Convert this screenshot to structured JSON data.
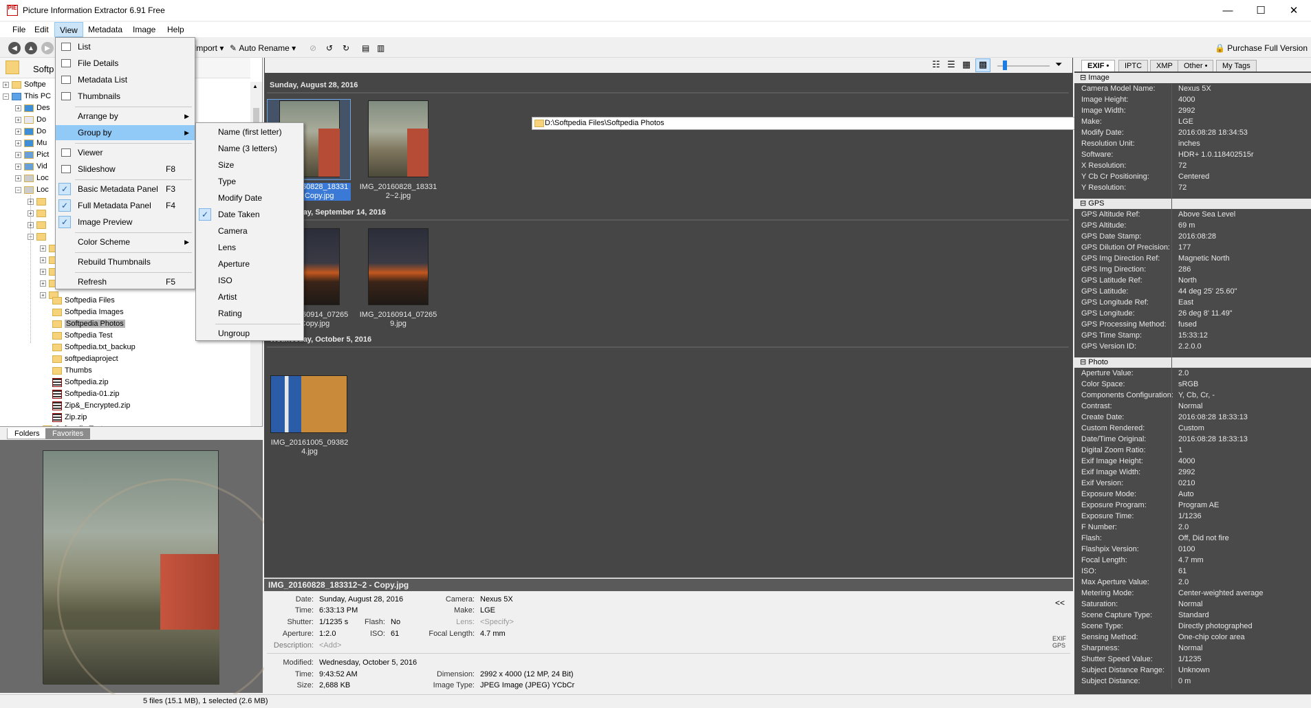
{
  "window": {
    "title": "Picture Information Extractor 6.91 Free",
    "app_icon": "PIE",
    "min": "—",
    "max": "☐",
    "close": "✕"
  },
  "menubar": [
    "File",
    "Edit",
    "View",
    "Metadata",
    "Image",
    "Help"
  ],
  "toolbar": {
    "import": "Import",
    "auto_rename": "Auto Rename",
    "purchase": "Purchase Full Version"
  },
  "tree": {
    "top": [
      {
        "label": "Softp"
      },
      {
        "label": "Softpe"
      },
      {
        "label": "This PC"
      },
      {
        "label": "Des"
      },
      {
        "label": "Do"
      },
      {
        "label": "Do"
      },
      {
        "label": "Mu"
      },
      {
        "label": "Pict"
      },
      {
        "label": "Vid"
      },
      {
        "label": "Loc"
      },
      {
        "label": "Loc"
      }
    ],
    "items": [
      {
        "label": "Softpedia Files",
        "type": "folder"
      },
      {
        "label": "Softpedia Images",
        "type": "folder"
      },
      {
        "label": "Softpedia Photos",
        "type": "folder"
      },
      {
        "label": "Softpedia Test",
        "type": "folder"
      },
      {
        "label": "Softpedia.txt_backup",
        "type": "folder"
      },
      {
        "label": "softpediaproject",
        "type": "folder"
      },
      {
        "label": "Thumbs",
        "type": "folder"
      },
      {
        "label": "Softpedia.zip",
        "type": "zip"
      },
      {
        "label": "Softpedia-01.zip",
        "type": "zip"
      },
      {
        "label": "Zip&_Encrypted.zip",
        "type": "zip"
      },
      {
        "label": "Zip.zip",
        "type": "zip"
      },
      {
        "label": "Softpedia Test",
        "type": "folder"
      }
    ]
  },
  "left_tabs": [
    "Folders",
    "Favorites"
  ],
  "path": "D:\\Softpedia Files\\Softpedia Photos",
  "groups": [
    {
      "label": "Sunday, August 28, 2016",
      "thumbs": [
        {
          "caption": "IMG_20160828_18331\n2~2 - Copy.jpg"
        },
        {
          "caption": "IMG_20160828_18331\n2~2.jpg"
        }
      ]
    },
    {
      "label": "Wednesday, September 14, 2016",
      "thumbs": [
        {
          "caption": "IMG_20160914_07265\n9 - Copy.jpg"
        },
        {
          "caption": "IMG_20160914_07265\n9.jpg"
        }
      ]
    },
    {
      "label": "Wednesday, October 5, 2016",
      "thumbs": [
        {
          "caption": "IMG_20161005_09382\n4.jpg"
        }
      ]
    }
  ],
  "info": {
    "title": "IMG_20160828_183312~2 - Copy.jpg",
    "date_l": "Date:",
    "date": "Sunday, August 28, 2016",
    "time_l": "Time:",
    "time": "6:33:13 PM",
    "shutter_l": "Shutter:",
    "shutter": "1/1235 s",
    "flash_l": "Flash:",
    "flash": "No",
    "aperture_l": "Aperture:",
    "aperture": "1:2.0",
    "iso_l": "ISO:",
    "iso": "61",
    "desc_l": "Description:",
    "desc": "<Add>",
    "camera_l": "Camera:",
    "camera": "Nexus 5X",
    "make_l": "Make:",
    "make": "LGE",
    "lens_l": "Lens:",
    "lens": "<Specify>",
    "focal_l": "Focal Length:",
    "focal": "4.7 mm",
    "collapse": "<<",
    "exif": "EXIF",
    "gps": "GPS",
    "modified_l": "Modified:",
    "modified": "Wednesday, October 5, 2016",
    "mtime_l": "Time:",
    "mtime": "9:43:52 AM",
    "size_l": "Size:",
    "size": "2,688 KB",
    "dim_l": "Dimension:",
    "dim": "2992 x 4000 (12 MP, 24 Bit)",
    "type_l": "Image Type:",
    "type": "JPEG Image (JPEG) YCbCr"
  },
  "right_tabs": [
    "EXIF •",
    "IPTC",
    "XMP",
    "Other •",
    "My Tags"
  ],
  "metadata": [
    {
      "section": "Image",
      "rows": [
        [
          "Camera Model Name:",
          "Nexus 5X"
        ],
        [
          "Image Height:",
          "4000"
        ],
        [
          "Image Width:",
          "2992"
        ],
        [
          "Make:",
          "LGE"
        ],
        [
          "Modify Date:",
          "2016:08:28 18:34:53"
        ],
        [
          "Resolution Unit:",
          "inches"
        ],
        [
          "Software:",
          "HDR+ 1.0.118402515r"
        ],
        [
          "X Resolution:",
          "72"
        ],
        [
          "Y Cb Cr Positioning:",
          "Centered"
        ],
        [
          "Y Resolution:",
          "72"
        ]
      ]
    },
    {
      "section": "GPS",
      "rows": [
        [
          "GPS Altitude Ref:",
          "Above Sea Level"
        ],
        [
          "GPS Altitude:",
          "69 m"
        ],
        [
          "GPS Date Stamp:",
          "2016:08:28"
        ],
        [
          "GPS Dilution Of Precision:",
          "177"
        ],
        [
          "GPS Img Direction Ref:",
          "Magnetic North"
        ],
        [
          "GPS Img Direction:",
          "286"
        ],
        [
          "GPS Latitude Ref:",
          "North"
        ],
        [
          "GPS Latitude:",
          "44 deg 25' 25.60\""
        ],
        [
          "GPS Longitude Ref:",
          "East"
        ],
        [
          "GPS Longitude:",
          "26 deg 8' 11.49\""
        ],
        [
          "GPS Processing Method:",
          "fused"
        ],
        [
          "GPS Time Stamp:",
          "15:33:12"
        ],
        [
          "GPS Version ID:",
          "2.2.0.0"
        ]
      ]
    },
    {
      "section": "Photo",
      "rows": [
        [
          "Aperture Value:",
          "2.0"
        ],
        [
          "Color Space:",
          "sRGB"
        ],
        [
          "Components Configuration:",
          "Y, Cb, Cr, -"
        ],
        [
          "Contrast:",
          "Normal"
        ],
        [
          "Create Date:",
          "2016:08:28 18:33:13"
        ],
        [
          "Custom Rendered:",
          "Custom"
        ],
        [
          "Date/Time Original:",
          "2016:08:28 18:33:13"
        ],
        [
          "Digital Zoom Ratio:",
          "1"
        ],
        [
          "Exif Image Height:",
          "4000"
        ],
        [
          "Exif Image Width:",
          "2992"
        ],
        [
          "Exif Version:",
          "0210"
        ],
        [
          "Exposure Mode:",
          "Auto"
        ],
        [
          "Exposure Program:",
          "Program AE"
        ],
        [
          "Exposure Time:",
          "1/1236"
        ],
        [
          "F Number:",
          "2.0"
        ],
        [
          "Flash:",
          "Off, Did not fire"
        ],
        [
          "Flashpix Version:",
          "0100"
        ],
        [
          "Focal Length:",
          "4.7 mm"
        ],
        [
          "ISO:",
          "61"
        ],
        [
          "Max Aperture Value:",
          "2.0"
        ],
        [
          "Metering Mode:",
          "Center-weighted average"
        ],
        [
          "Saturation:",
          "Normal"
        ],
        [
          "Scene Capture Type:",
          "Standard"
        ],
        [
          "Scene Type:",
          "Directly photographed"
        ],
        [
          "Sensing Method:",
          "One-chip color area"
        ],
        [
          "Sharpness:",
          "Normal"
        ],
        [
          "Shutter Speed Value:",
          "1/1235"
        ],
        [
          "Subject Distance Range:",
          "Unknown"
        ],
        [
          "Subject Distance:",
          "0 m"
        ]
      ]
    }
  ],
  "status": "5 files (15.1 MB), 1 selected (2.6 MB)",
  "view_menu": [
    {
      "label": "List",
      "icon": "list-icon"
    },
    {
      "label": "File Details",
      "icon": "details-icon"
    },
    {
      "label": "Metadata List",
      "icon": "metadata-list-icon"
    },
    {
      "label": "Thumbnails",
      "icon": "thumbnails-icon"
    },
    {
      "sep": true
    },
    {
      "label": "Arrange by",
      "sub": true
    },
    {
      "label": "Group by",
      "sub": true,
      "hl": true
    },
    {
      "sep": true
    },
    {
      "label": "Viewer",
      "icon": "viewer-icon"
    },
    {
      "label": "Slideshow",
      "shortcut": "F8",
      "icon": "slideshow-icon"
    },
    {
      "sep": true
    },
    {
      "label": "Basic Metadata Panel",
      "shortcut": "F3",
      "check": true
    },
    {
      "label": "Full Metadata Panel",
      "shortcut": "F4",
      "check": true
    },
    {
      "label": "Image Preview",
      "check": true
    },
    {
      "sep": true
    },
    {
      "label": "Color Scheme",
      "sub": true
    },
    {
      "sep": true
    },
    {
      "label": "Rebuild Thumbnails"
    },
    {
      "sep": true
    },
    {
      "label": "Refresh",
      "shortcut": "F5"
    }
  ],
  "group_menu": [
    {
      "label": "Name (first letter)"
    },
    {
      "label": "Name (3 letters)"
    },
    {
      "label": "Size"
    },
    {
      "label": "Type"
    },
    {
      "label": "Modify Date"
    },
    {
      "label": "Date Taken",
      "check": true
    },
    {
      "label": "Camera"
    },
    {
      "label": "Lens"
    },
    {
      "label": "Aperture"
    },
    {
      "label": "ISO"
    },
    {
      "label": "Artist"
    },
    {
      "label": "Rating"
    },
    {
      "sep": true
    },
    {
      "label": "Ungroup"
    }
  ]
}
